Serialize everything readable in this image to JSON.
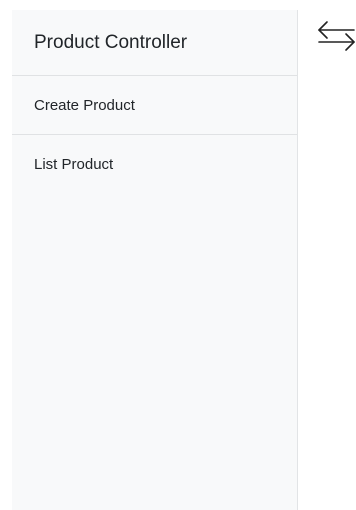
{
  "sidebar": {
    "heading": "Product Controller",
    "items": [
      {
        "label": "Create Product"
      },
      {
        "label": "List Product"
      }
    ]
  },
  "toggle": {
    "icon": "arrows-left-right-icon"
  },
  "colors": {
    "sidebar_bg": "#f8f9fa",
    "divider": "#e0e2e4",
    "text": "#212529"
  }
}
